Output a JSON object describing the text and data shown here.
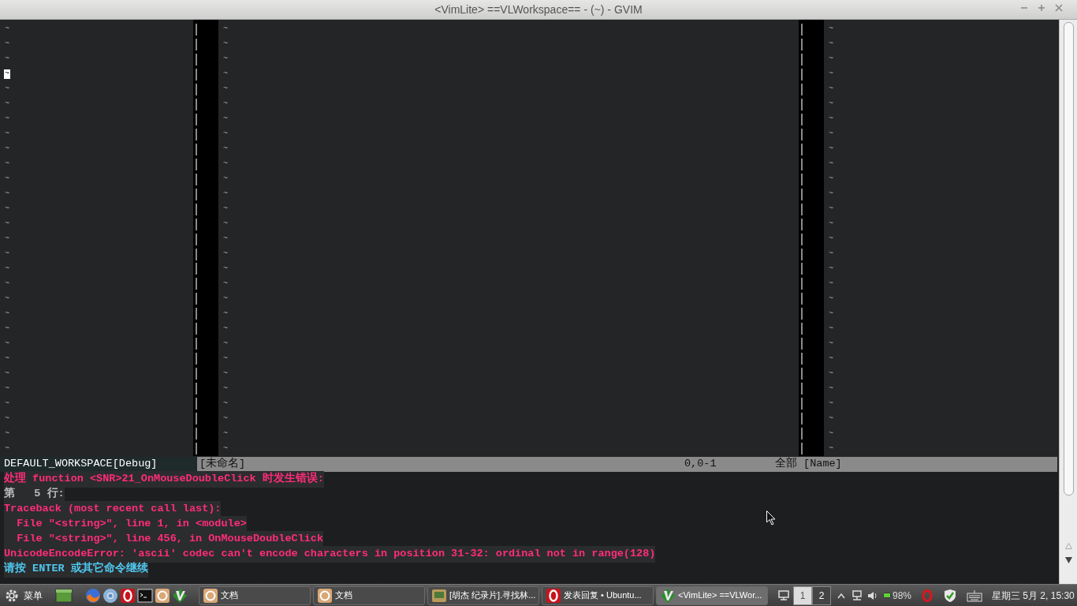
{
  "window": {
    "title": "<VimLite> ==VLWorkspace== - (~) - GVIM"
  },
  "panes": [
    {
      "lines": [
        {
          "text": "~",
          "cursor": false
        },
        {
          "text": "~",
          "cursor": false
        },
        {
          "text": "~",
          "cursor": false
        },
        {
          "text": "~",
          "cursor": true
        },
        {
          "text": "~",
          "cursor": false
        },
        {
          "text": "~",
          "cursor": false
        },
        {
          "text": "~",
          "cursor": false
        },
        {
          "text": "~",
          "cursor": false
        },
        {
          "text": "~",
          "cursor": false
        },
        {
          "text": "~",
          "cursor": false
        },
        {
          "text": "~",
          "cursor": false
        },
        {
          "text": "~",
          "cursor": false
        },
        {
          "text": "~",
          "cursor": false
        },
        {
          "text": "~",
          "cursor": false
        },
        {
          "text": "~",
          "cursor": false
        },
        {
          "text": "~",
          "cursor": false
        },
        {
          "text": "~",
          "cursor": false
        },
        {
          "text": "~",
          "cursor": false
        },
        {
          "text": "~",
          "cursor": false
        },
        {
          "text": "~",
          "cursor": false
        },
        {
          "text": "~",
          "cursor": false
        },
        {
          "text": "~",
          "cursor": false
        },
        {
          "text": "~",
          "cursor": false
        },
        {
          "text": "~",
          "cursor": false
        },
        {
          "text": "~",
          "cursor": false
        },
        {
          "text": "~",
          "cursor": false
        },
        {
          "text": "~",
          "cursor": false
        },
        {
          "text": "~",
          "cursor": false
        },
        {
          "text": "~",
          "cursor": false
        }
      ]
    },
    {
      "lines": [
        {
          "text": "~",
          "cursor": false
        },
        {
          "text": "~",
          "cursor": false
        },
        {
          "text": "~",
          "cursor": false
        },
        {
          "text": "~",
          "cursor": false
        },
        {
          "text": "~",
          "cursor": false
        },
        {
          "text": "~",
          "cursor": false
        },
        {
          "text": "~",
          "cursor": false
        },
        {
          "text": "~",
          "cursor": false
        },
        {
          "text": "~",
          "cursor": false
        },
        {
          "text": "~",
          "cursor": false
        },
        {
          "text": "~",
          "cursor": false
        },
        {
          "text": "~",
          "cursor": false
        },
        {
          "text": "~",
          "cursor": false
        },
        {
          "text": "~",
          "cursor": false
        },
        {
          "text": "~",
          "cursor": false
        },
        {
          "text": "~",
          "cursor": false
        },
        {
          "text": "~",
          "cursor": false
        },
        {
          "text": "~",
          "cursor": false
        },
        {
          "text": "~",
          "cursor": false
        },
        {
          "text": "~",
          "cursor": false
        },
        {
          "text": "~",
          "cursor": false
        },
        {
          "text": "~",
          "cursor": false
        },
        {
          "text": "~",
          "cursor": false
        },
        {
          "text": "~",
          "cursor": false
        },
        {
          "text": "~",
          "cursor": false
        },
        {
          "text": "~",
          "cursor": false
        },
        {
          "text": "~",
          "cursor": false
        },
        {
          "text": "~",
          "cursor": false
        },
        {
          "text": "~",
          "cursor": false
        }
      ]
    },
    {
      "lines": [
        {
          "text": "~",
          "cursor": false
        },
        {
          "text": "~",
          "cursor": false
        },
        {
          "text": "~",
          "cursor": false
        },
        {
          "text": "~",
          "cursor": false
        },
        {
          "text": "~",
          "cursor": false
        },
        {
          "text": "~",
          "cursor": false
        },
        {
          "text": "~",
          "cursor": false
        },
        {
          "text": "~",
          "cursor": false
        },
        {
          "text": "~",
          "cursor": false
        },
        {
          "text": "~",
          "cursor": false
        },
        {
          "text": "~",
          "cursor": false
        },
        {
          "text": "~",
          "cursor": false
        },
        {
          "text": "~",
          "cursor": false
        },
        {
          "text": "~",
          "cursor": false
        },
        {
          "text": "~",
          "cursor": false
        },
        {
          "text": "~",
          "cursor": false
        },
        {
          "text": "~",
          "cursor": false
        },
        {
          "text": "~",
          "cursor": false
        },
        {
          "text": "~",
          "cursor": false
        },
        {
          "text": "~",
          "cursor": false
        },
        {
          "text": "~",
          "cursor": false
        },
        {
          "text": "~",
          "cursor": false
        },
        {
          "text": "~",
          "cursor": false
        },
        {
          "text": "~",
          "cursor": false
        },
        {
          "text": "~",
          "cursor": false
        },
        {
          "text": "~",
          "cursor": false
        },
        {
          "text": "~",
          "cursor": false
        },
        {
          "text": "~",
          "cursor": false
        },
        {
          "text": "~",
          "cursor": false
        }
      ]
    }
  ],
  "status_line": {
    "workspace": "DEFAULT_WORKSPACE[Debug]",
    "file": "[未命名]",
    "position": "0,0-1",
    "scroll": "全部 [Name]"
  },
  "messages": [
    {
      "kind": "error",
      "text": "处理 function <SNR>21_OnMouseDoubleClick 时发生错误:"
    },
    {
      "kind": "linenr",
      "text": "第   5 行:"
    },
    {
      "kind": "error",
      "text": "Traceback (most recent call last):"
    },
    {
      "kind": "error",
      "text": "  File \"<string>\", line 1, in <module>"
    },
    {
      "kind": "error",
      "text": "  File \"<string>\", line 456, in OnMouseDoubleClick"
    },
    {
      "kind": "error",
      "text": "UnicodeEncodeError: 'ascii' codec can't encode characters in position 31-32: ordinal not in range(128)"
    },
    {
      "kind": "prompt",
      "text": "请按 ENTER 或其它命令继续"
    }
  ],
  "taskbar": {
    "menu": "菜单",
    "launchers": [
      {
        "kind": "firefox"
      },
      {
        "kind": "chrome"
      },
      {
        "kind": "opera"
      },
      {
        "kind": "terminal"
      },
      {
        "kind": "docs"
      },
      {
        "kind": "vim"
      }
    ],
    "windows": [
      {
        "kind": "docs",
        "label": "文档",
        "selected": false
      },
      {
        "kind": "docs",
        "label": "文档",
        "selected": false
      },
      {
        "kind": "video",
        "label": "[胡杰 纪录片].寻找林...",
        "selected": false
      },
      {
        "kind": "opera",
        "label": "发表回复 • Ubuntu...",
        "selected": false
      },
      {
        "kind": "vim",
        "label": "<VimLite> ==VLWor...",
        "selected": true
      }
    ],
    "workspaces": [
      {
        "label": "1",
        "selected": true
      },
      {
        "label": "2",
        "selected": false
      }
    ],
    "battery": "98%",
    "clock": "星期三 5月 2, 15:30"
  }
}
